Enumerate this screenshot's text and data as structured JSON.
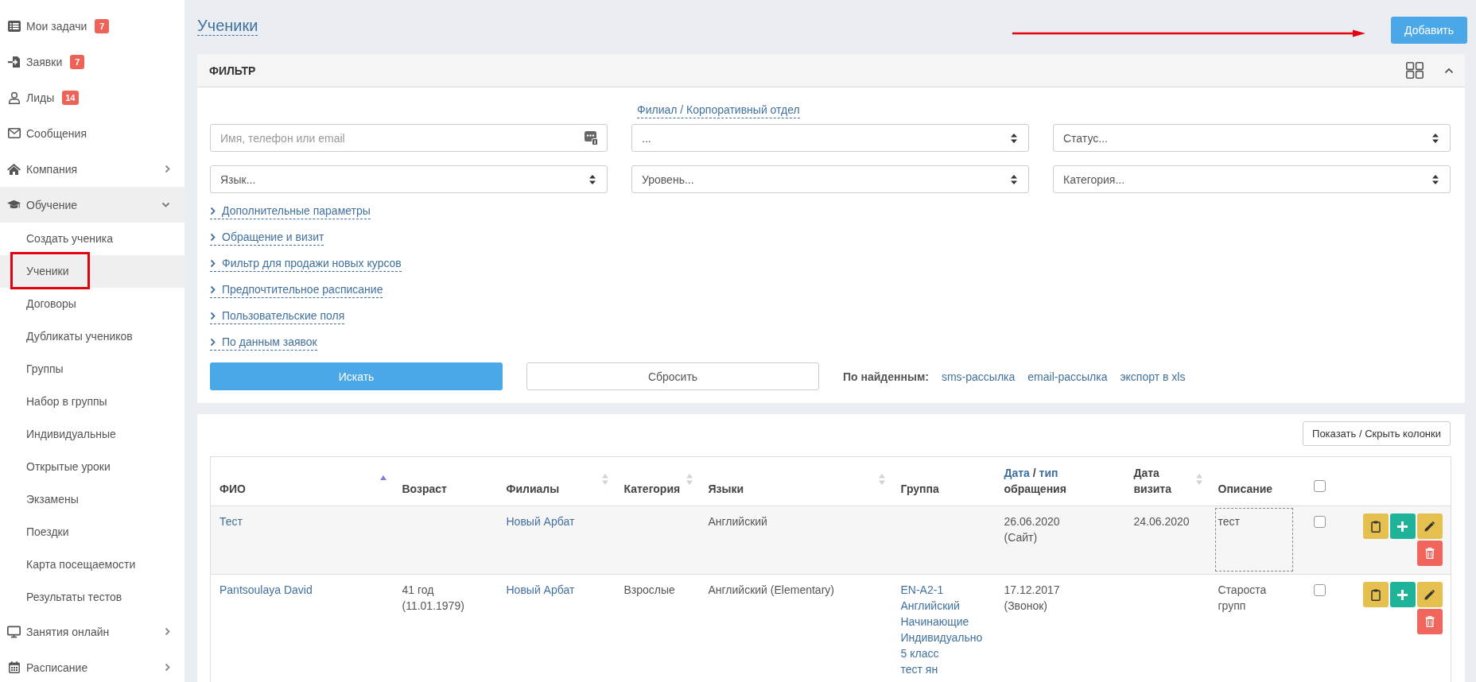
{
  "sidebar": {
    "items": [
      {
        "label": "Мои задачи",
        "badge": "7",
        "selected": false
      },
      {
        "label": "Заявки",
        "badge": "7",
        "selected": false
      },
      {
        "label": "Лиды",
        "badge": "14",
        "selected": false
      },
      {
        "label": "Сообщения",
        "selected": false
      },
      {
        "label": "Компания",
        "selected": false,
        "expanded": false
      },
      {
        "label": "Обучение",
        "selected": true,
        "expanded": true,
        "children": [
          {
            "label": "Создать ученика",
            "selected": false
          },
          {
            "label": "Ученики",
            "selected": true
          },
          {
            "label": "Договоры",
            "selected": false
          },
          {
            "label": "Дубликаты учеников",
            "selected": false
          },
          {
            "label": "Группы",
            "selected": false
          },
          {
            "label": "Набор в группы",
            "selected": false
          },
          {
            "label": "Индивидуальные",
            "selected": false
          },
          {
            "label": "Открытые уроки",
            "selected": false
          },
          {
            "label": "Экзамены",
            "selected": false
          },
          {
            "label": "Поездки",
            "selected": false
          },
          {
            "label": "Карта посещаемости",
            "selected": false
          },
          {
            "label": "Результаты тестов",
            "selected": false
          }
        ]
      },
      {
        "label": "Занятия онлайн",
        "selected": false,
        "expanded": false
      },
      {
        "label": "Расписание",
        "selected": false,
        "expanded": false
      }
    ]
  },
  "page": {
    "title": "Ученики",
    "add_button": "Добавить"
  },
  "filter": {
    "title": "ФИЛЬТР",
    "expanded": true,
    "branch_label": "Филиал / Корпоративный отдел",
    "fields": [
      {
        "kind": "search",
        "placeholder": "Имя, телефон или email"
      },
      {
        "kind": "select",
        "value": "..."
      },
      {
        "kind": "select",
        "value": "Статус..."
      },
      {
        "kind": "select",
        "value": "Язык..."
      },
      {
        "kind": "select",
        "value": "Уровень..."
      },
      {
        "kind": "select",
        "value": "Категория..."
      }
    ],
    "sections": [
      {
        "label": "Дополнительные параметры",
        "expanded": false
      },
      {
        "label": "Обращение и визит",
        "expanded": false
      },
      {
        "label": "Фильтр для продажи новых курсов",
        "expanded": false
      },
      {
        "label": "Предпочтительное расписание",
        "expanded": false
      },
      {
        "label": "Пользовательские поля",
        "expanded": false
      },
      {
        "label": "По данным заявок",
        "expanded": false
      }
    ],
    "search_button": "Искать",
    "reset_button": "Сбросить",
    "results": {
      "label": "По найденным:",
      "links": [
        "sms-рассылка",
        "email-рассылка",
        "экспорт в xls"
      ]
    }
  },
  "table": {
    "columns_button": "Показать / Скрыть колонки",
    "columns": [
      {
        "kind": "text",
        "label": "ФИО",
        "sorted": true
      },
      {
        "kind": "text",
        "label": "Возраст"
      },
      {
        "kind": "text",
        "label": "Филиалы",
        "sorted": false
      },
      {
        "kind": "text",
        "label": "Категория",
        "sorted": false
      },
      {
        "kind": "text",
        "label": "Языки",
        "sorted": false
      },
      {
        "kind": "text",
        "label": "Группа"
      },
      {
        "kind": "links",
        "links": [
          "Дата",
          "тип"
        ],
        "separator": "/",
        "label": "обращения"
      },
      {
        "kind": "text",
        "label": "Дата визита",
        "sorted": false
      },
      {
        "kind": "text",
        "label": "Описание"
      },
      {
        "kind": "checkbox",
        "checked": false
      }
    ],
    "rows": [
      {
        "hovered": true,
        "checked": false,
        "name": "Тест",
        "branch": "Новый Арбат",
        "languages": "Английский",
        "request": "26.06.2020\n(Сайт)",
        "visit": "24.06.2020",
        "description": "тест"
      },
      {
        "hovered": false,
        "checked": false,
        "name": "Pantsoulaya David",
        "age": "41 год\n(11.01.1979)",
        "branch": "Новый Арбат",
        "category": "Взрослые",
        "languages": "Английский (Elementary)",
        "groups": [
          "EN-A2-1 Английский Начинающие Индивидуально 5 класс",
          "тест ян"
        ],
        "request": "17.12.2017\n(Звонок)",
        "description": "Староста групп"
      }
    ]
  }
}
